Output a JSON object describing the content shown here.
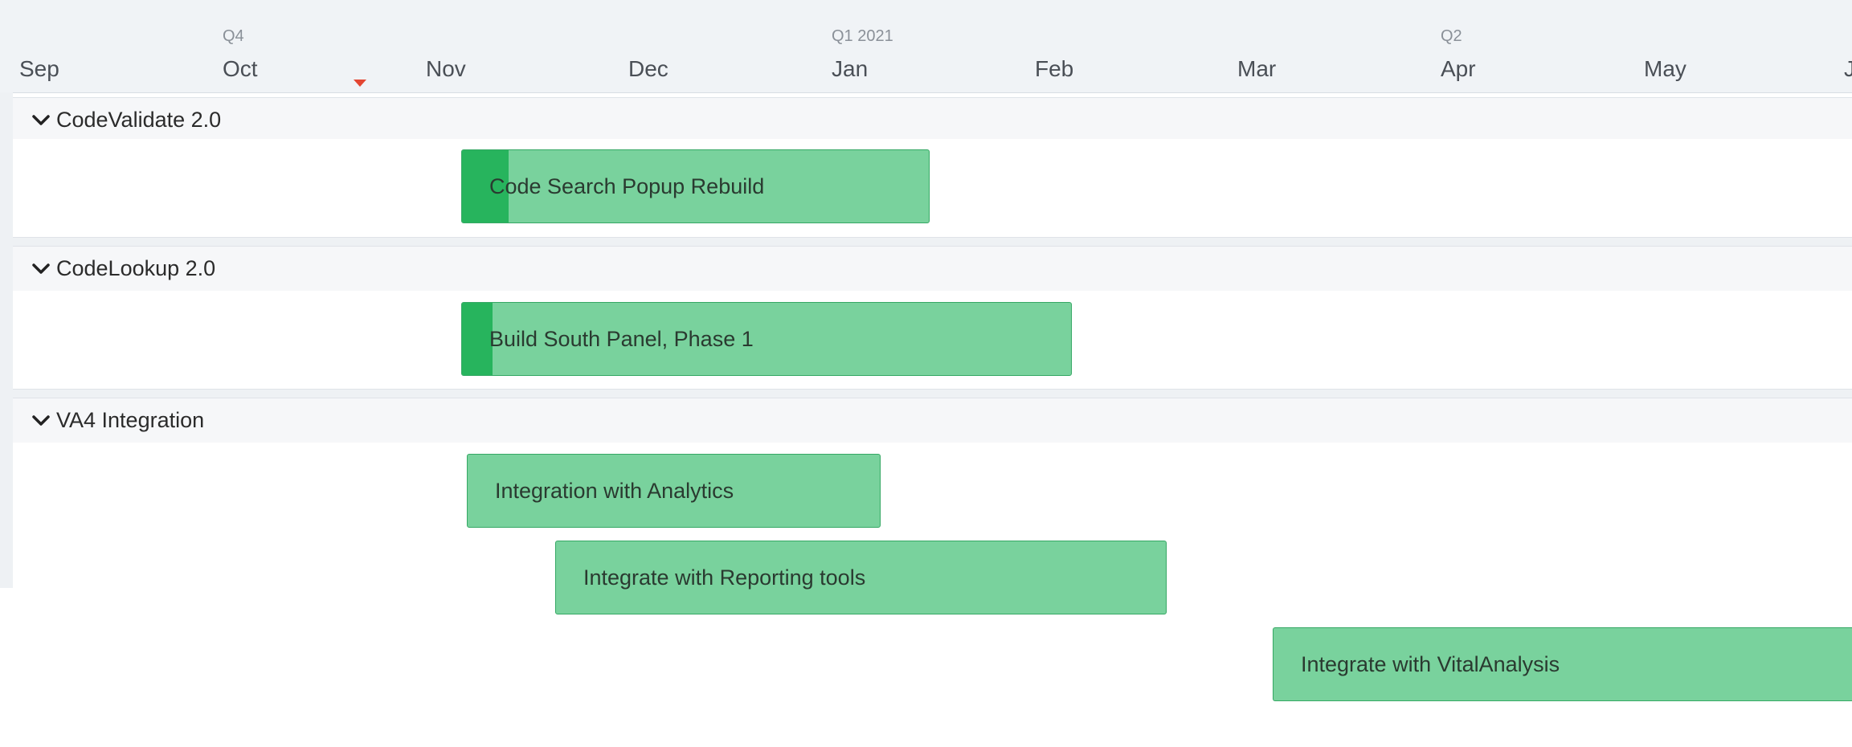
{
  "timeline": {
    "quarters": [
      "Q4",
      "Q1 2021",
      "Q2"
    ],
    "months": [
      "Sep",
      "Oct",
      "Nov",
      "Dec",
      "Jan",
      "Feb",
      "Mar",
      "Apr",
      "May",
      "J"
    ]
  },
  "groups": [
    {
      "title": "CodeValidate 2.0",
      "tasks": [
        {
          "label": "Code Search Popup Rebuild",
          "progress": 0.1
        }
      ]
    },
    {
      "title": "CodeLookup 2.0",
      "tasks": [
        {
          "label": "Build South Panel, Phase 1",
          "progress": 0.05
        }
      ]
    },
    {
      "title": "VA4 Integration",
      "tasks": [
        {
          "label": "Integration with Analytics",
          "progress": 0
        },
        {
          "label": "Integrate with Reporting tools",
          "progress": 0
        },
        {
          "label": "Integrate with VitalAnalysis",
          "progress": 0
        }
      ]
    }
  ],
  "colors": {
    "bar_fill": "#79d29d",
    "bar_border": "#35a864",
    "progress_fill": "#27b45d",
    "today_marker": "#e34632",
    "header_bg": "#f0f3f6"
  }
}
